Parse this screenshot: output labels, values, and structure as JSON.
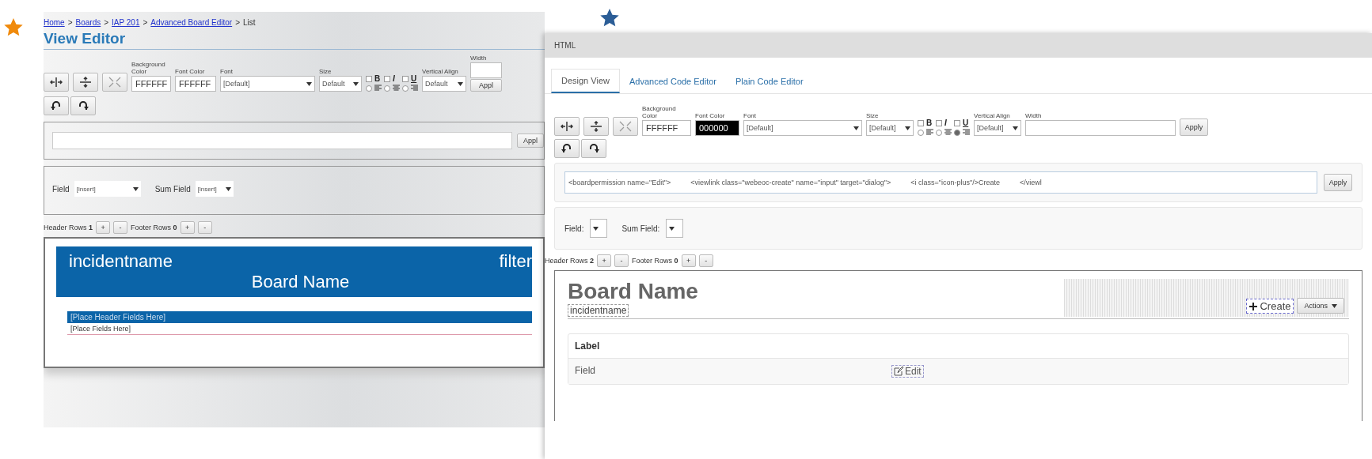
{
  "left_window": {
    "breadcrumb": {
      "separator": ">",
      "items": [
        {
          "label": "Home",
          "link": true
        },
        {
          "label": "Boards",
          "link": true
        },
        {
          "label": "IAP 201",
          "link": true
        },
        {
          "label": "Advanced Board Editor",
          "link": true
        },
        {
          "label": "List",
          "link": false
        }
      ]
    },
    "title": "View Editor",
    "toolbar": {
      "bg_label": "Background Color",
      "bg_value": "FFFFFF",
      "font_color_label": "Font Color",
      "font_color_value": "FFFFFF",
      "font_label": "Font",
      "font_value": "[Default]",
      "size_label": "Size",
      "size_value": "Default",
      "styles": [
        {
          "kind": "bold",
          "text": "B",
          "checked": false
        },
        {
          "kind": "italic",
          "text": "I",
          "checked": false
        },
        {
          "kind": "underline",
          "text": "U",
          "checked": false
        }
      ],
      "aligns": [
        {
          "selected": false
        },
        {
          "selected": false
        },
        {
          "selected": false
        }
      ],
      "valign_label": "Vertical Align",
      "valign_value": "Default",
      "width_label": "Width",
      "apply": "Appl"
    },
    "code": {
      "apply": "Appl"
    },
    "fields": {
      "field_label": "Field",
      "field_value": "[insert]",
      "sum_label": "Sum Field",
      "sum_value": "[insert]"
    },
    "rows": {
      "header_label": "Header Rows",
      "header_count": "1",
      "footer_label": "Footer Rows",
      "footer_count": "0",
      "plus": "+",
      "minus": "-"
    },
    "preview": {
      "incident": "incidentname",
      "filter": "filter",
      "board_name": "Board Name",
      "header_fields": "[Place Header Fields Here]",
      "fields": "[Place Fields Here]"
    }
  },
  "right_window": {
    "title": "HTML",
    "tabs": [
      {
        "label": "Design View",
        "selected": true
      },
      {
        "label": "Advanced Code Editor",
        "selected": false
      },
      {
        "label": "Plain Code Editor",
        "selected": false
      }
    ],
    "toolbar": {
      "bg_label": "Background Color",
      "bg_value": "FFFFFF",
      "font_color_label": "Font Color",
      "font_color_value": "000000",
      "font_label": "Font",
      "font_value": "[Default]",
      "size_label": "Size",
      "size_value": "[Default]",
      "styles": [
        {
          "kind": "bold",
          "text": "B",
          "checked": false
        },
        {
          "kind": "italic",
          "text": "I",
          "checked": false
        },
        {
          "kind": "underline",
          "text": "U",
          "checked": false
        }
      ],
      "aligns": [
        {
          "selected": false
        },
        {
          "selected": false
        },
        {
          "selected": true
        }
      ],
      "valign_label": "Vertical Align",
      "valign_value": "[Default]",
      "width_label": "Width",
      "apply": "Apply"
    },
    "code": {
      "value": "<boardpermission name=\"Edit\">          <viewlink class=\"webeoc-create\" name=\"input\" target=\"dialog\">          <i class=\"icon-plus\"/>Create          </viewl",
      "apply": "Apply"
    },
    "fields": {
      "field_label": "Field:",
      "sum_label": "Sum Field:"
    },
    "rows": {
      "header_label": "Header Rows",
      "header_count": "2",
      "footer_label": "Footer Rows",
      "footer_count": "0",
      "plus": "+",
      "minus": "-"
    },
    "preview": {
      "board_name": "Board Name",
      "incident": "incidentname",
      "create": "Create",
      "actions": "Actions",
      "table_header": "Label",
      "field": "Field",
      "edit": "Edit"
    }
  }
}
